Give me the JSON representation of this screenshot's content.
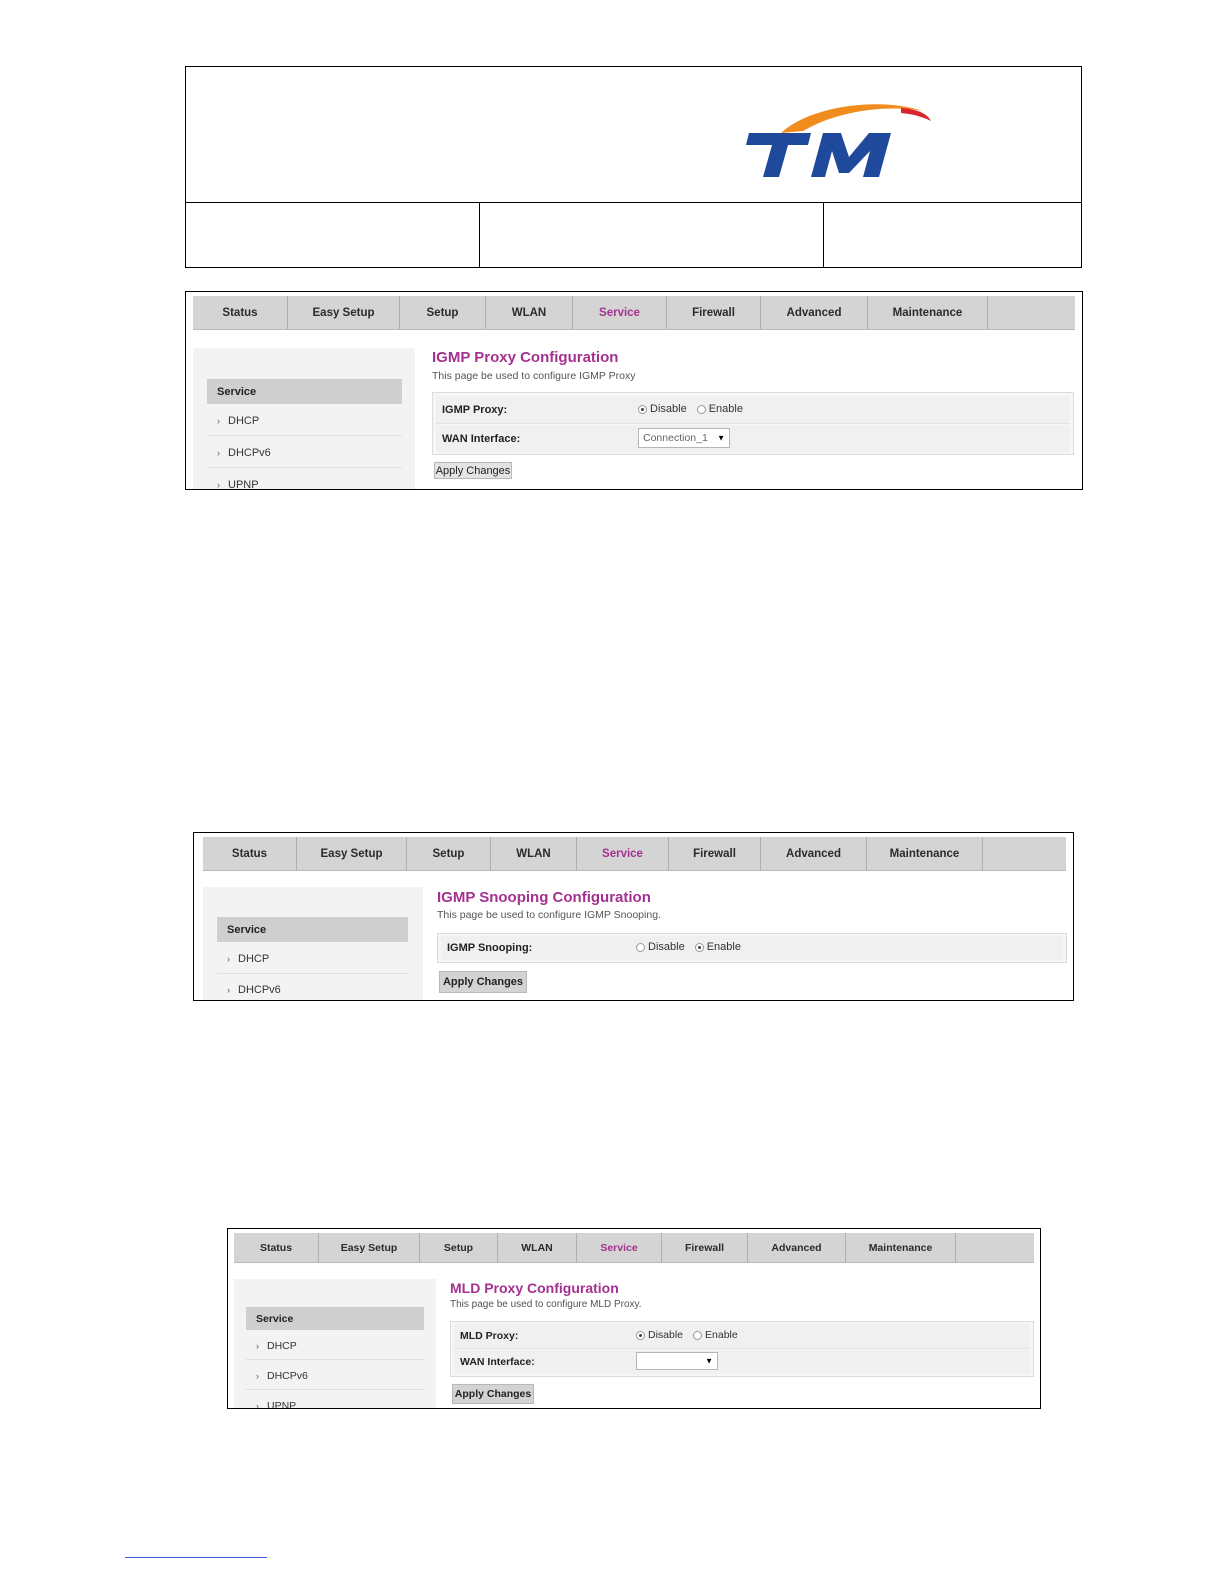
{
  "brand": {
    "logo_text": "TM",
    "blue": "#1f4a9c",
    "orange": "#f08c1e",
    "red": "#d8252e"
  },
  "nav": [
    "Status",
    "Easy Setup",
    "Setup",
    "WLAN",
    "Service",
    "Firewall",
    "Advanced",
    "Maintenance"
  ],
  "active_nav": "Service",
  "accent": "#a4318f",
  "shot1": {
    "sidebar": {
      "heading": "Service",
      "items": [
        "DHCP",
        "DHCPv6",
        "UPNP"
      ]
    },
    "title": "IGMP Proxy Configuration",
    "description": "This page be used to configure IGMP Proxy",
    "rows": [
      {
        "label": "IGMP Proxy:",
        "options": [
          "Disable",
          "Enable"
        ],
        "selected": "Disable"
      },
      {
        "label": "WAN Interface:",
        "select_value": "Connection_1"
      }
    ],
    "apply": "Apply Changes"
  },
  "shot2": {
    "sidebar": {
      "heading": "Service",
      "items": [
        "DHCP",
        "DHCPv6"
      ]
    },
    "title": "IGMP Snooping Configuration",
    "description": "This page be used to configure IGMP Snooping.",
    "rows": [
      {
        "label": "IGMP Snooping:",
        "options": [
          "Disable",
          "Enable"
        ],
        "selected": "Enable"
      }
    ],
    "apply": "Apply Changes"
  },
  "shot3": {
    "sidebar": {
      "heading": "Service",
      "items": [
        "DHCP",
        "DHCPv6",
        "UPNP"
      ]
    },
    "title": "MLD Proxy Configuration",
    "description": "This page be used to configure MLD Proxy.",
    "rows": [
      {
        "label": "MLD Proxy:",
        "options": [
          "Disable",
          "Enable"
        ],
        "selected": "Disable"
      },
      {
        "label": "WAN Interface:",
        "select_value": ""
      }
    ],
    "apply": "Apply Changes"
  }
}
